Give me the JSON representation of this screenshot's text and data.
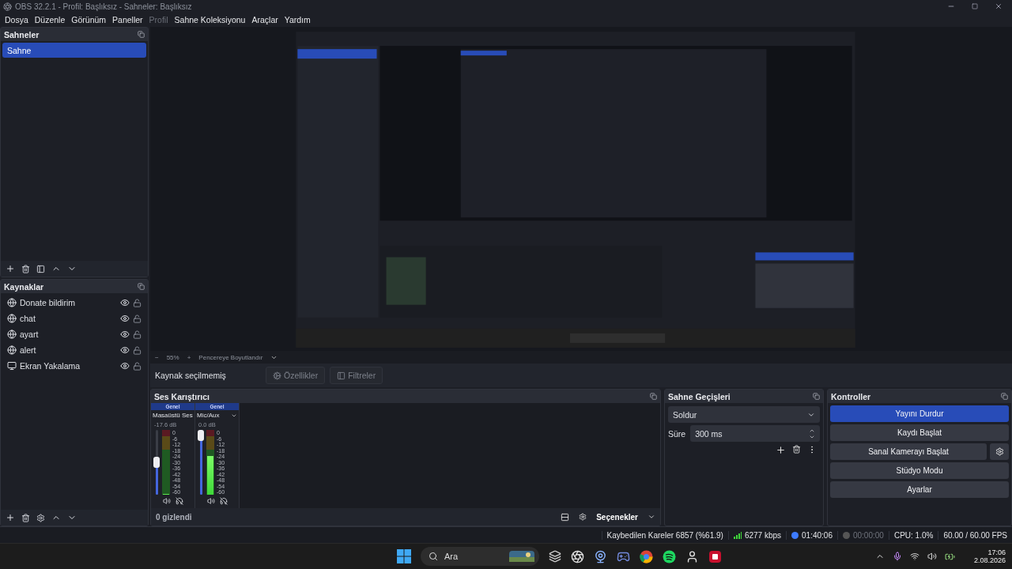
{
  "window": {
    "title": "OBS 32.2.1 - Profil: Başlıksız - Sahneler: Başlıksız"
  },
  "menu": [
    {
      "label": "Dosya",
      "disabled": false
    },
    {
      "label": "Düzenle",
      "disabled": false
    },
    {
      "label": "Görünüm",
      "disabled": false
    },
    {
      "label": "Paneller",
      "disabled": false
    },
    {
      "label": "Profil",
      "disabled": true
    },
    {
      "label": "Sahne Koleksiyonu",
      "disabled": false
    },
    {
      "label": "Araçlar",
      "disabled": false
    },
    {
      "label": "Yardım",
      "disabled": false
    }
  ],
  "scenes": {
    "title": "Sahneler",
    "items": [
      {
        "name": "Sahne",
        "selected": true
      }
    ]
  },
  "sources": {
    "title": "Kaynaklar",
    "items": [
      {
        "name": "Donate bildirim",
        "kind": "browser",
        "visible": true,
        "locked": false
      },
      {
        "name": "chat",
        "kind": "browser",
        "visible": true,
        "locked": false
      },
      {
        "name": "ayart",
        "kind": "browser",
        "visible": true,
        "locked": false
      },
      {
        "name": "alert",
        "kind": "browser",
        "visible": true,
        "locked": false
      },
      {
        "name": "Ekran Yakalama",
        "kind": "display",
        "visible": true,
        "locked": false
      }
    ]
  },
  "preview_zoom": {
    "zoom_out": "−",
    "zoom": "55%",
    "zoom_in": "+",
    "fit": "Pencereye Boyutlandır"
  },
  "context": {
    "label": "Kaynak seçilmemiş",
    "buttons": [
      {
        "label": "Özellikler",
        "kind": "properties",
        "disabled": true
      },
      {
        "label": "Filtreler",
        "kind": "filters",
        "disabled": true
      }
    ]
  },
  "mixer": {
    "title": "Ses Karıştırıcı",
    "channels": [
      {
        "tag": "Genel",
        "name": "Masaüstü Ses",
        "reading": "-17.6 dB",
        "fader": {
          "level": 0.5
        },
        "meter": {
          "level": 0
        },
        "scale": [
          "0",
          "-6",
          "-12",
          "-18",
          "-24",
          "-30",
          "-36",
          "-42",
          "-48",
          "-54",
          "-60"
        ]
      },
      {
        "tag": "Genel",
        "name": "Mic/Aux",
        "reading": "0.0 dB",
        "fader": {
          "level": 1
        },
        "meter": {
          "level": 0.6
        },
        "scale": [
          "0",
          "-6",
          "-12",
          "-18",
          "-24",
          "-30",
          "-36",
          "-42",
          "-48",
          "-54",
          "-60"
        ]
      }
    ],
    "hidden": "0 gizlendi",
    "options": "Seçenekler"
  },
  "transitions": {
    "title": "Sahne Geçişleri",
    "selected": "Soldur",
    "duration_label": "Süre",
    "duration": "300 ms"
  },
  "controls": {
    "title": "Kontroller",
    "buttons": [
      {
        "label": "Yayını Durdur",
        "active": true,
        "settings": false
      },
      {
        "label": "Kaydı Başlat",
        "active": false,
        "settings": false
      },
      {
        "label": "Sanal Kamerayı Başlat",
        "active": false,
        "settings": true
      },
      {
        "label": "Stüdyo Modu",
        "active": false,
        "settings": false
      },
      {
        "label": "Ayarlar",
        "active": false,
        "settings": false
      }
    ]
  },
  "status_bar": {
    "dropped": "Kaybedilen Kareler 6857 (%61.9)",
    "bitrate": "6277 kbps",
    "streaming": true,
    "stream_time": "01:40:06",
    "recording": false,
    "record_time": "00:00:00",
    "cpu": "CPU: 1.0%",
    "fps": "60.00 / 60.00 FPS"
  },
  "taskbar": {
    "search": {
      "placeholder": "Ara"
    },
    "time": "17:06",
    "date": "2.08.2026"
  }
}
